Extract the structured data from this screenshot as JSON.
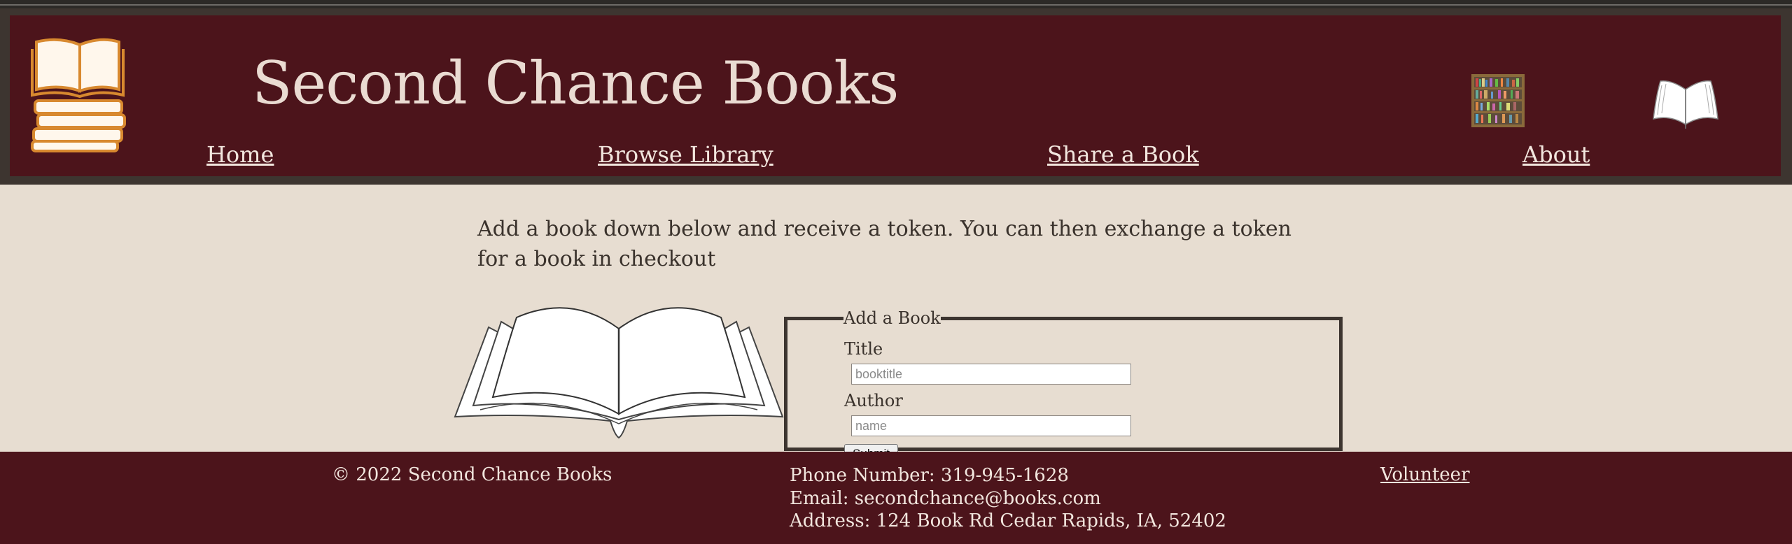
{
  "site": {
    "title": "Second Chance Books"
  },
  "nav": {
    "home": "Home",
    "browse": "Browse Library",
    "share": "Share a Book",
    "about": "About"
  },
  "main": {
    "intro": "Add a book down below and receive a token. You can then exchange a token for a book in checkout"
  },
  "form": {
    "legend": "Add a Book",
    "title_label": "Title",
    "title_placeholder": "booktitle",
    "title_value": "",
    "author_label": "Author",
    "author_placeholder": "name",
    "author_value": "",
    "submit_label": "Submit"
  },
  "footer": {
    "copyright": "© 2022 Second Chance Books",
    "phone": "Phone Number: 319-945-1628",
    "email": "Email: secondchance@books.com",
    "address": "Address: 124 Book Rd Cedar Rapids, IA, 52402",
    "volunteer": "Volunteer"
  },
  "icons": {
    "logo": "book-stack-logo-icon",
    "shelf": "bookshelf-icon",
    "open_book_small": "open-book-icon",
    "open_book_large": "open-book-illustration"
  },
  "colors": {
    "header_bg": "#4c141b",
    "header_frame": "#3d3530",
    "page_bg": "#e7ddd1",
    "text_light": "#eadbd2",
    "text_dark": "#3a322c"
  }
}
